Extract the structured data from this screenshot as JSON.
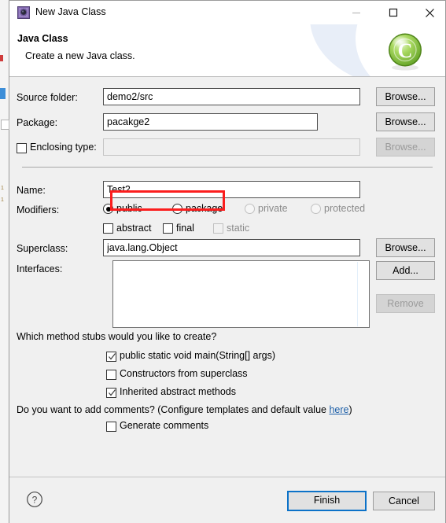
{
  "window": {
    "title": "New Java Class",
    "icon": "java-class-wizard-icon",
    "minimize": "–",
    "maximize": "□",
    "close": "✕"
  },
  "header": {
    "title": "Java Class",
    "subtitle": "Create a new Java class.",
    "logo": "green-c-class-icon",
    "logo_letter": "C"
  },
  "form": {
    "source_folder": {
      "label": "Source folder:",
      "value": "demo2/src",
      "browse": "Browse..."
    },
    "package": {
      "label": "Package:",
      "value": "pacakge2",
      "browse": "Browse...",
      "annotated": true,
      "annotation_color": "#fb1e1e"
    },
    "enclosing_type": {
      "label": "Enclosing type:",
      "checked": false,
      "value": "",
      "browse": "Browse...",
      "disabled": true
    },
    "name": {
      "label": "Name:",
      "value": "Test2"
    },
    "modifiers": {
      "label": "Modifiers:",
      "access": [
        {
          "label": "public",
          "selected": true,
          "disabled": false
        },
        {
          "label": "package",
          "selected": false,
          "disabled": false
        },
        {
          "label": "private",
          "selected": false,
          "disabled": true
        },
        {
          "label": "protected",
          "selected": false,
          "disabled": true
        }
      ],
      "flags": [
        {
          "label": "abstract",
          "checked": false,
          "disabled": false
        },
        {
          "label": "final",
          "checked": false,
          "disabled": false
        },
        {
          "label": "static",
          "checked": false,
          "disabled": true
        }
      ]
    },
    "superclass": {
      "label": "Superclass:",
      "value": "java.lang.Object",
      "browse": "Browse..."
    },
    "interfaces": {
      "label": "Interfaces:",
      "items": [],
      "add": "Add...",
      "remove": "Remove",
      "remove_disabled": true
    },
    "method_stubs": {
      "question": "Which method stubs would you like to create?",
      "options": [
        {
          "label": "public static void main(String[] args)",
          "checked": true
        },
        {
          "label": "Constructors from superclass",
          "checked": false
        },
        {
          "label": "Inherited abstract methods",
          "checked": true
        }
      ]
    },
    "comments": {
      "question_prefix": "Do you want to add comments? (Configure templates and default value ",
      "link": "here",
      "question_suffix": ")",
      "option": {
        "label": "Generate comments",
        "checked": false
      }
    }
  },
  "footer": {
    "help": "?",
    "finish": "Finish",
    "cancel": "Cancel"
  }
}
